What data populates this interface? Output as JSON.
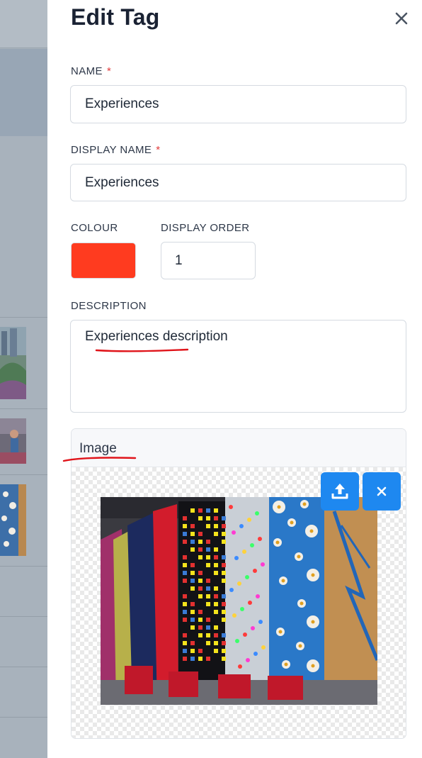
{
  "drawer": {
    "title": "Edit Tag",
    "close_icon": "close-icon"
  },
  "form": {
    "name": {
      "label": "NAME",
      "required_mark": "*",
      "value": "Experiences"
    },
    "display_name": {
      "label": "DISPLAY NAME",
      "required_mark": "*",
      "value": "Experiences"
    },
    "colour": {
      "label": "COLOUR",
      "value": "#ff3b1f"
    },
    "display_order": {
      "label": "DISPLAY ORDER",
      "value": "1"
    },
    "description": {
      "label": "DESCRIPTION",
      "value": "Experiences description"
    }
  },
  "image_section": {
    "title": "Image",
    "upload_icon": "upload-icon",
    "remove_icon": "close-icon",
    "photo_subject": "indoor climbing walls"
  },
  "colors": {
    "accent_blue": "#1e88f0",
    "required_red": "#e23b3b",
    "annotation_red": "#e0141a",
    "backdrop": "#a8b2bc"
  }
}
